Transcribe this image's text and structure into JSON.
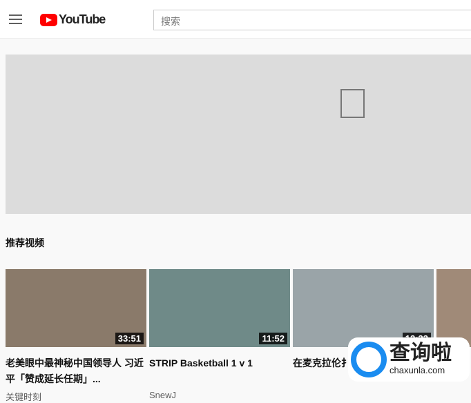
{
  "header": {
    "logo": "YouTube",
    "search_placeholder": "搜索"
  },
  "section_title": "推荐视频",
  "videos": [
    {
      "title": "老美眼中最神秘中国领导人 习近平「赞成延长任期」...",
      "channel": "关键时刻",
      "duration": "33:51",
      "thumb": "#8a7a6a"
    },
    {
      "title": "STRIP Basketball 1 v 1",
      "channel": "SnewJ",
      "duration": "11:52",
      "thumb": "#6f8a88"
    },
    {
      "title": "在麦克拉伦扌...手!",
      "channel": "",
      "duration": "12:33",
      "thumb": "#9aa4a8"
    }
  ],
  "watermark": {
    "name": "查询啦",
    "domain": "chaxunla.com"
  }
}
